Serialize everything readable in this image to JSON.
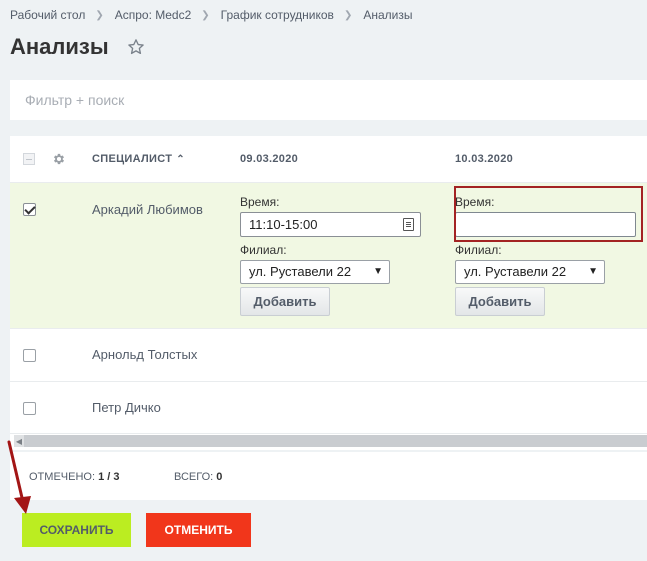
{
  "breadcrumb": [
    "Рабочий стол",
    "Аспро: Medc2",
    "График сотрудников",
    "Анализы"
  ],
  "page_title": "Анализы",
  "filter": {
    "placeholder": "Фильтр + поиск"
  },
  "grid": {
    "headers": {
      "specialist": "СПЕЦИАЛИСТ",
      "date1": "09.03.2020",
      "date2": "10.03.2020"
    },
    "rows": [
      {
        "name": "Аркадий Любимов",
        "checked": true,
        "cells": [
          {
            "time_label": "Время:",
            "time_value": "11:10-15:00",
            "branch_label": "Филиал:",
            "branch_value": "ул. Руставели 22",
            "add_label": "Добавить"
          },
          {
            "time_label": "Время:",
            "time_value": "",
            "branch_label": "Филиал:",
            "branch_value": "ул. Руставели 22",
            "add_label": "Добавить"
          }
        ]
      },
      {
        "name": "Арнольд Толстых",
        "checked": false
      },
      {
        "name": "Петр Дичко",
        "checked": false
      }
    ]
  },
  "footer": {
    "selected_label": "ОТМЕЧЕНО:",
    "selected_value": "1 / 3",
    "total_label": "ВСЕГО:",
    "total_value": "0"
  },
  "buttons": {
    "save": "СОХРАНИТЬ",
    "cancel": "ОТМЕНИТЬ"
  },
  "colors": {
    "save_bg": "#bbed21",
    "cancel_bg": "#f1361b",
    "highlight": "#a32323",
    "annotation_arrow": "#a31515",
    "selected_row_bg": "#f1f8e3"
  },
  "icons": {
    "favorite": "star-icon",
    "settings": "gear-icon",
    "sort": "chevron-up-icon",
    "calendar": "calendar-icon",
    "dropdown": "triangle-down-icon"
  }
}
